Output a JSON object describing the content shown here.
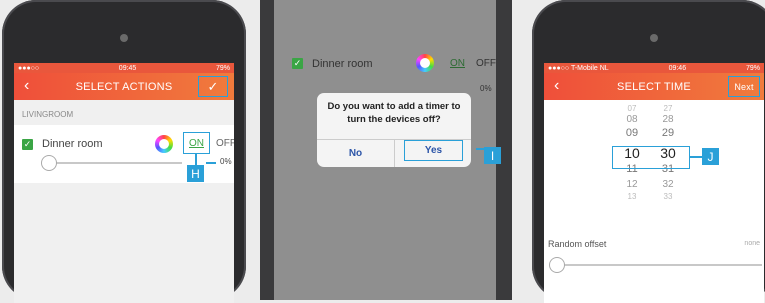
{
  "screen1": {
    "status": {
      "carrier": "●●●○○",
      "time": "09:45",
      "battery": "79%"
    },
    "title": "SELECT ACTIONS",
    "section": "LIVINGROOM",
    "device": "Dinner room",
    "on": "ON",
    "off": "OFF",
    "percent": "0%",
    "callout": "H"
  },
  "screen2": {
    "device": "Dinner room",
    "on": "ON",
    "off": "OFF",
    "percent": "0%",
    "dialog_text": "Do you want to add a timer to turn the devices off?",
    "no": "No",
    "yes": "Yes",
    "callout": "I"
  },
  "screen3": {
    "status": {
      "carrier": "●●●○○ T-Mobile NL",
      "time": "09:46",
      "battery": "79%"
    },
    "title": "SELECT TIME",
    "next": "Next",
    "hours": [
      "07",
      "08",
      "09",
      "10",
      "11",
      "12",
      "13"
    ],
    "minutes": [
      "27",
      "28",
      "29",
      "30",
      "31",
      "32",
      "33"
    ],
    "random_label": "Random offset",
    "random_value": "none",
    "callout": "J"
  }
}
